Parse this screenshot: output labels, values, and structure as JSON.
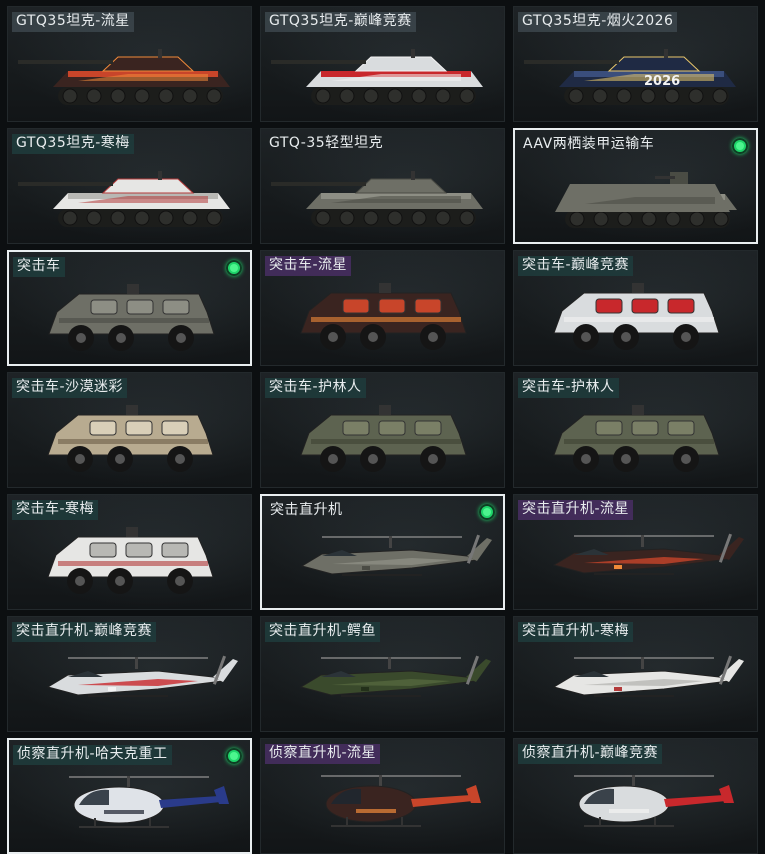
{
  "accent_color": "#1fd46a",
  "vehicles": [
    {
      "label": "GTQ35坦克-流星",
      "type": "tank",
      "skin": "meteor",
      "equipped": false
    },
    {
      "label": "GTQ35坦克-巅峰竞赛",
      "type": "tank",
      "skin": "race",
      "equipped": false
    },
    {
      "label": "GTQ35坦克-烟火2026",
      "type": "tank",
      "skin": "firework",
      "decal": "2026",
      "equipped": false
    },
    {
      "label": "GTQ35坦克-寒梅",
      "type": "tank",
      "skin": "plum",
      "equipped": false
    },
    {
      "label": "GTQ-35轻型坦克",
      "type": "tank",
      "skin": "default",
      "equipped": false
    },
    {
      "label": "AAV两栖装甲运输车",
      "type": "amphibious",
      "skin": "default",
      "equipped": true
    },
    {
      "label": "突击车",
      "type": "car",
      "skin": "default",
      "equipped": true
    },
    {
      "label": "突击车-流星",
      "type": "car",
      "skin": "meteor",
      "equipped": false
    },
    {
      "label": "突击车-巅峰竞赛",
      "type": "car",
      "skin": "race",
      "equipped": false
    },
    {
      "label": "突击车-沙漠迷彩",
      "type": "car",
      "skin": "desert",
      "equipped": false
    },
    {
      "label": "突击车-护林人",
      "type": "car",
      "skin": "forest",
      "equipped": false
    },
    {
      "label": "突击车-护林人",
      "type": "car",
      "skin": "forest",
      "equipped": false
    },
    {
      "label": "突击车-寒梅",
      "type": "car",
      "skin": "plum",
      "equipped": false
    },
    {
      "label": "突击直升机",
      "type": "heli",
      "skin": "default",
      "equipped": true
    },
    {
      "label": "突击直升机-流星",
      "type": "heli",
      "skin": "meteor",
      "equipped": false
    },
    {
      "label": "突击直升机-巅峰竞赛",
      "type": "heli",
      "skin": "race",
      "equipped": false
    },
    {
      "label": "突击直升机-鳄鱼",
      "type": "heli",
      "skin": "croc",
      "equipped": false
    },
    {
      "label": "突击直升机-寒梅",
      "type": "heli",
      "skin": "plum",
      "equipped": false
    },
    {
      "label": "侦察直升机-哈夫克重工",
      "type": "scout",
      "skin": "haavk",
      "equipped": true
    },
    {
      "label": "侦察直升机-流星",
      "type": "scout",
      "skin": "meteor",
      "equipped": false
    },
    {
      "label": "侦察直升机-巅峰竞赛",
      "type": "scout",
      "skin": "race",
      "equipped": false
    }
  ]
}
